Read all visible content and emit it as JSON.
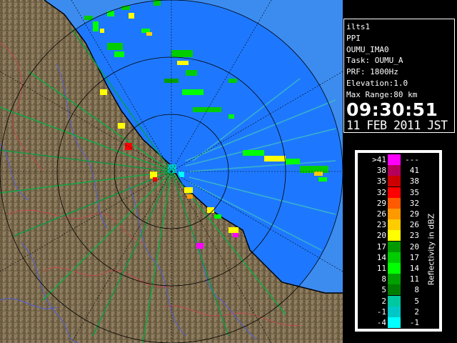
{
  "info": {
    "lines": [
      "ilts1",
      "PPI",
      "OUMU_IMA0",
      "Task: OUMU_A",
      "PRF: 1800Hz",
      "Elevation:1.0",
      "Max Range:80 km"
    ],
    "time": "09:30:51",
    "date": "11 FEB 2011 JST"
  },
  "legend": {
    "title": "Reflectivity in dBZ",
    "rows": [
      {
        "low": ">41",
        "high": "---",
        "color": "#ff00ff"
      },
      {
        "low": "38",
        "high": "41",
        "color": "#b4005a"
      },
      {
        "low": "35",
        "high": "38",
        "color": "#cc0000"
      },
      {
        "low": "32",
        "high": "35",
        "color": "#ff0000"
      },
      {
        "low": "29",
        "high": "32",
        "color": "#ff5a00"
      },
      {
        "low": "26",
        "high": "29",
        "color": "#ff9900"
      },
      {
        "low": "23",
        "high": "26",
        "color": "#ffcc00"
      },
      {
        "low": "20",
        "high": "23",
        "color": "#ffff00"
      },
      {
        "low": "17",
        "high": "20",
        "color": "#009900"
      },
      {
        "low": "14",
        "high": "17",
        "color": "#00cc00"
      },
      {
        "low": "11",
        "high": "14",
        "color": "#00ff00"
      },
      {
        "low": "8",
        "high": "11",
        "color": "#00a000"
      },
      {
        "low": "5",
        "high": "8",
        "color": "#007d00"
      },
      {
        "low": "2",
        "high": "5",
        "color": "#00c8a0"
      },
      {
        "low": "-1",
        "high": "2",
        "color": "#00c8c8"
      },
      {
        "low": "-4",
        "high": "-1",
        "color": "#00ffff"
      }
    ]
  },
  "map": {
    "sea_color": "#1e78ff",
    "outer_sea_color": "#3c8cf0",
    "land_color": "#7a6a4e",
    "range_ring_color": "#000000"
  }
}
